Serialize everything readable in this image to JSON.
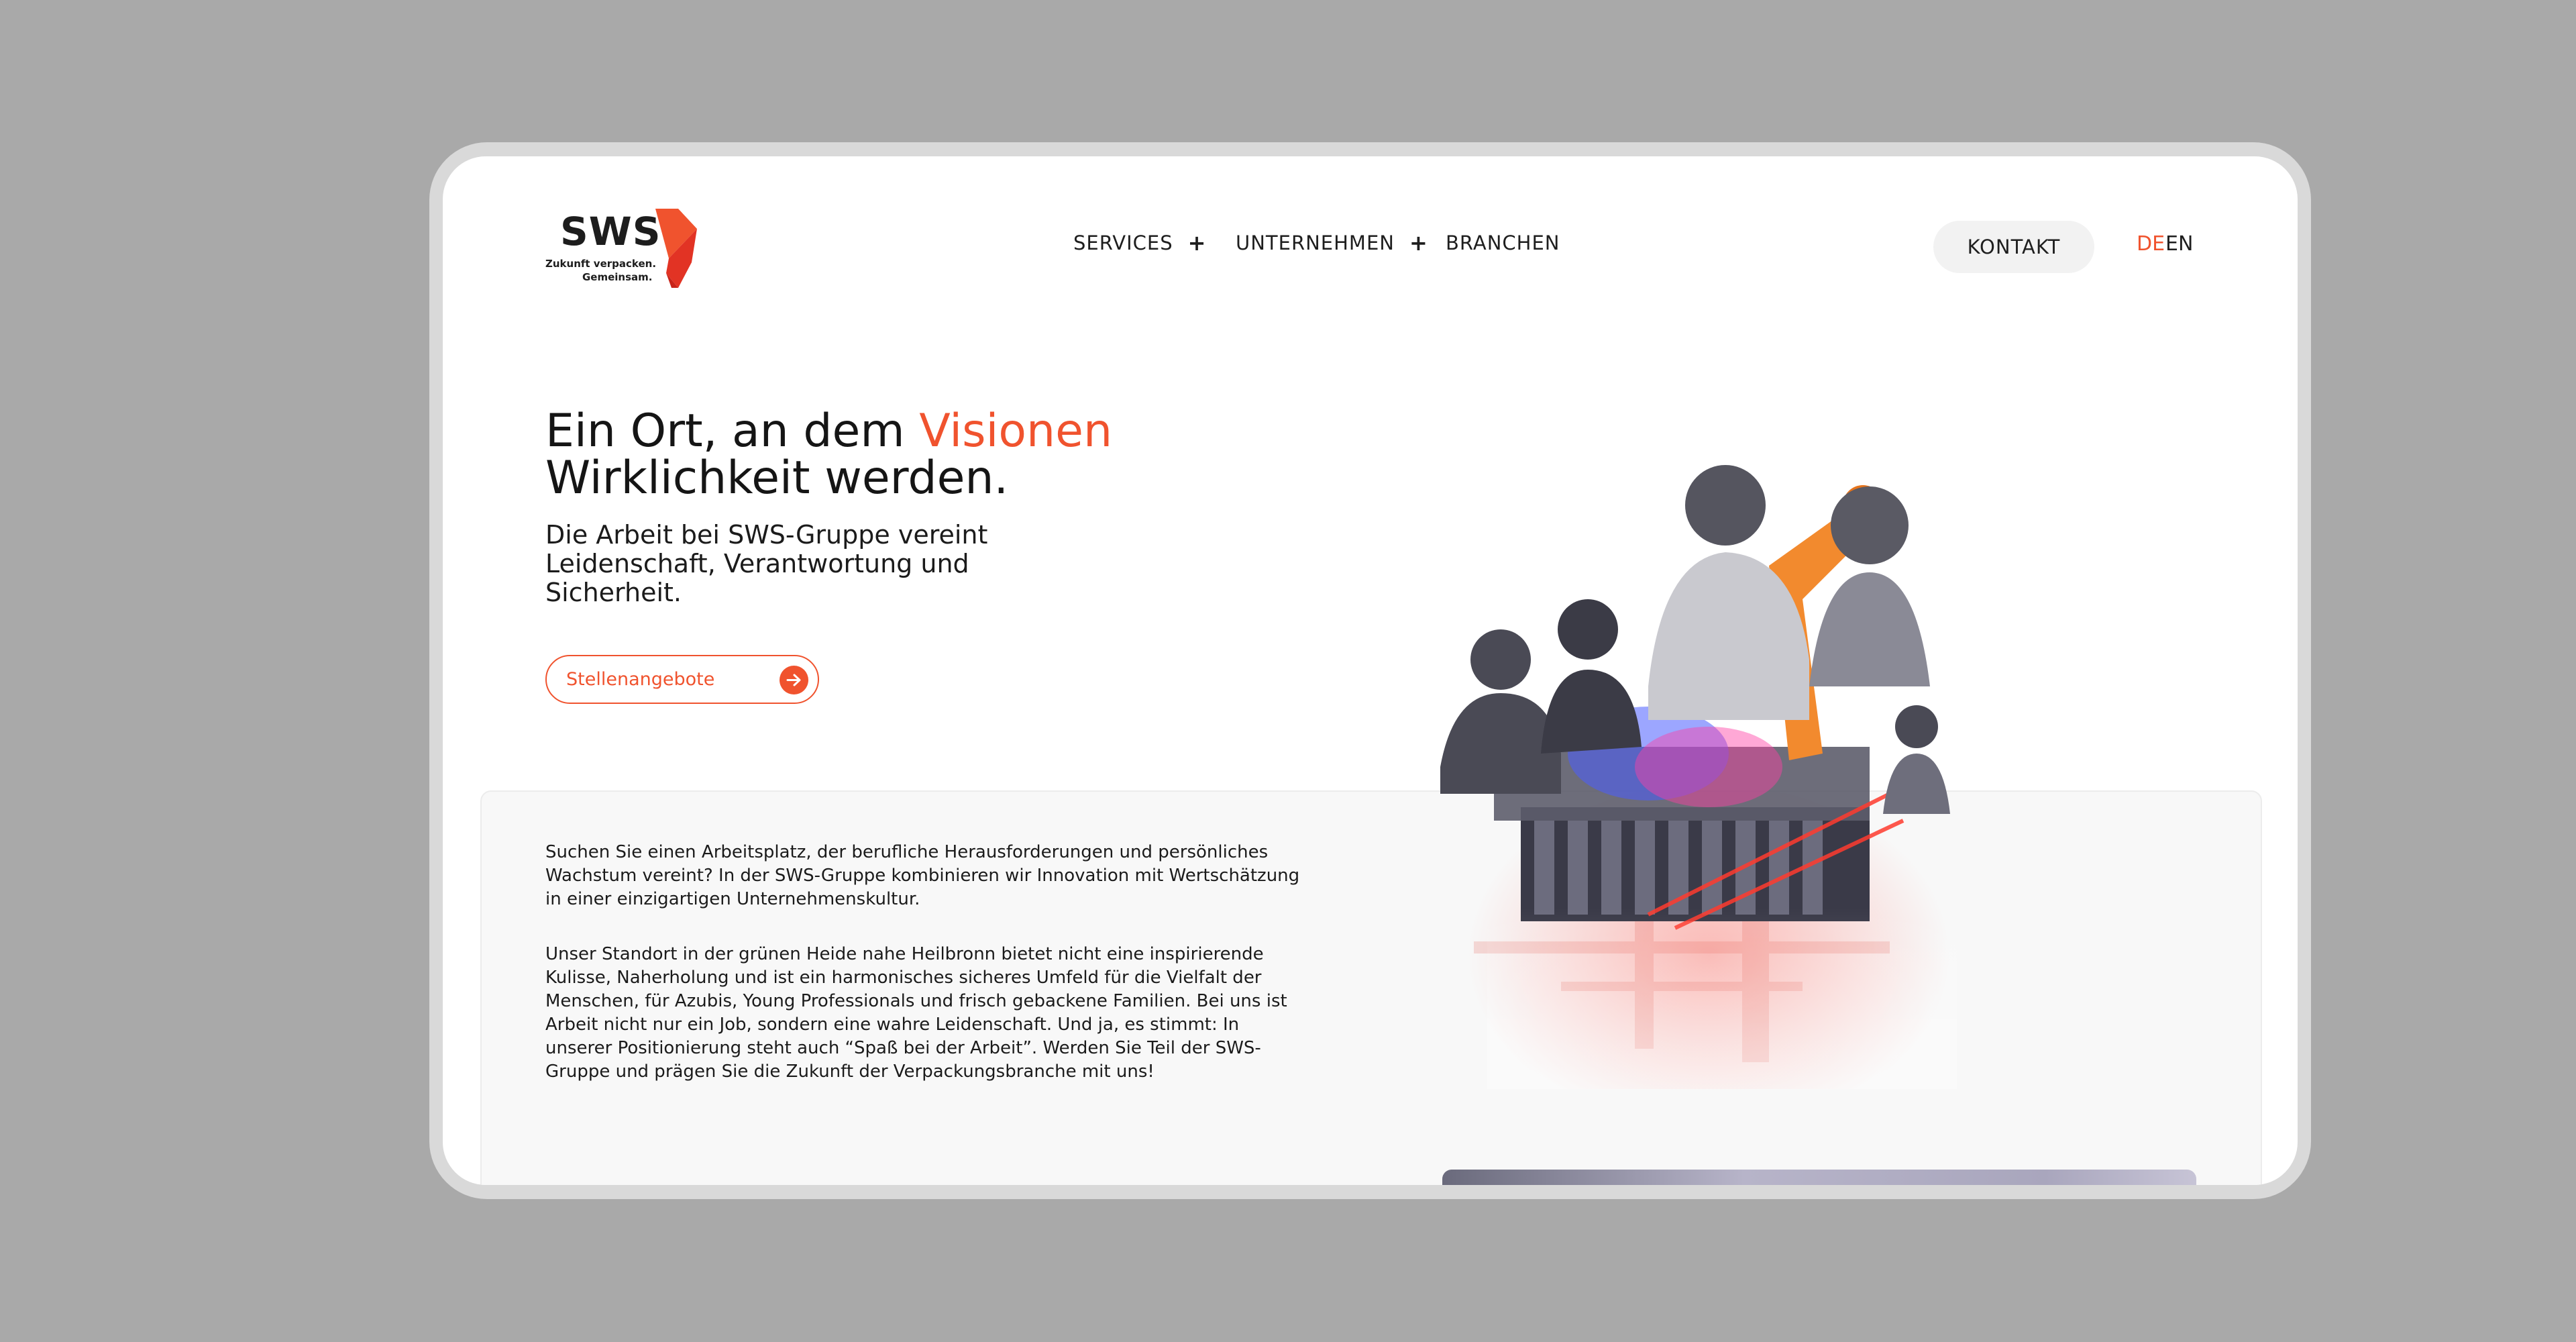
{
  "brand": {
    "name": "SWS",
    "tagline_line1": "Zukunft verpacken.",
    "tagline_line2": "Gemeinsam."
  },
  "nav": {
    "items": [
      {
        "label": "SERVICES",
        "has_submenu": true
      },
      {
        "label": "UNTERNEHMEN",
        "has_submenu": true
      },
      {
        "label": "BRANCHEN",
        "has_submenu": false
      }
    ],
    "submenu_symbol": "+",
    "contact_label": "KONTAKT",
    "languages": [
      {
        "code": "DE",
        "active": true
      },
      {
        "code": "EN",
        "active": false
      }
    ]
  },
  "hero": {
    "title_part1": "Ein Ort, an dem ",
    "title_accent": "Visionen",
    "title_part2": "Wirklichkeit werden.",
    "subtitle": "Die Arbeit bei SWS-Gruppe vereint Leidenschaft, Verantwortung und Sicherheit.",
    "cta_label": "Stellenangebote",
    "cta_icon": "arrow-right-icon"
  },
  "intro": {
    "paragraph1": "Suchen Sie einen Arbeitsplatz, der berufliche Herausforderungen und persönliches Wachstum vereint? In der SWS-Gruppe kombinieren wir Innovation mit Wertschätzung in einer einzigartigen Unternehmenskultur.",
    "paragraph2": "Unser Standort in der grünen Heide nahe Heilbronn bietet nicht eine inspirierende Kulisse, Naherholung und ist ein harmonisches sicheres Umfeld für die Vielfalt der Menschen, für Azubis, Young Professionals und frisch gebackene Familien. Bei uns ist Arbeit nicht nur ein Job, sondern eine wahre Leidenschaft. Und ja, es stimmt: In unserer Positionierung steht auch “Spaß bei der Arbeit”. Werden Sie Teil der SWS-Gruppe und prägen Sie die Zukunft der Verpackungsbranche mit uns!"
  },
  "colors": {
    "accent": "#f0532e",
    "text": "#1b1b1b",
    "background_outer": "#a9a9a9",
    "panel": "#f8f8f8"
  }
}
